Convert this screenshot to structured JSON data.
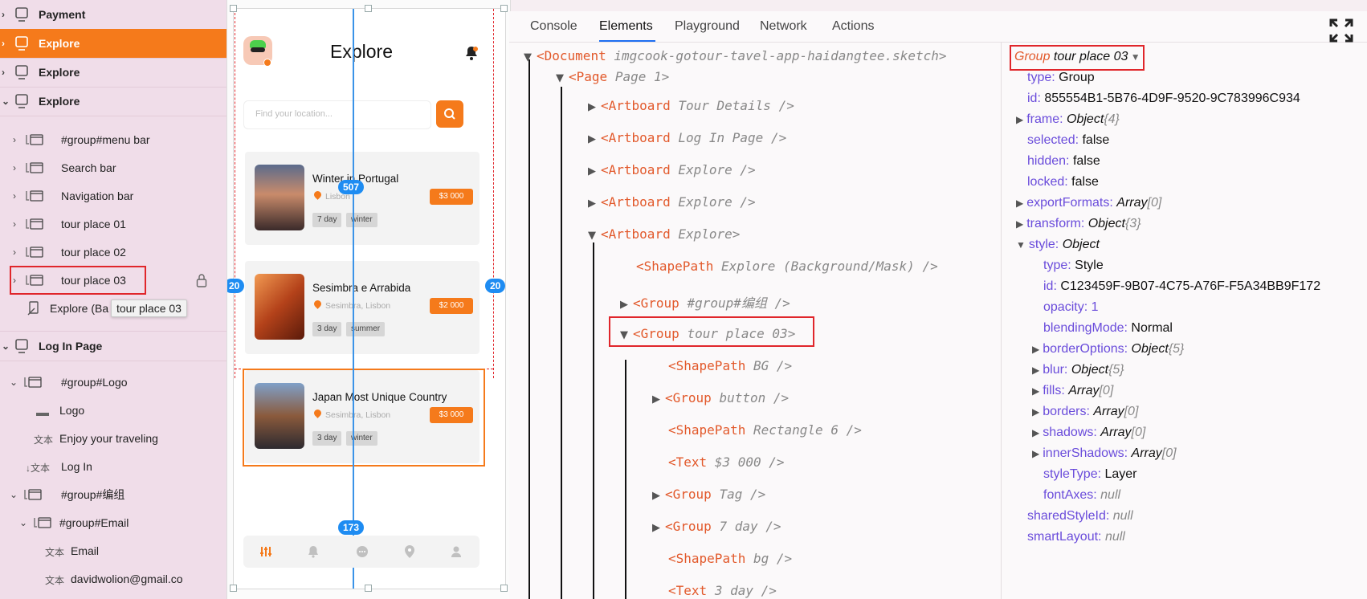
{
  "layers": {
    "artboards_top": [
      {
        "label": "Payment"
      },
      {
        "label": "Explore",
        "active": true
      },
      {
        "label": "Explore"
      },
      {
        "label": "Explore"
      }
    ],
    "explore_children": [
      {
        "label": "#group#menu bar"
      },
      {
        "label": "Search bar"
      },
      {
        "label": "Navigation bar"
      },
      {
        "label": "tour place 01"
      },
      {
        "label": "tour place 02"
      },
      {
        "label": "tour place 03",
        "selected": true
      }
    ],
    "mask_item": {
      "label": "Explore (Ba"
    },
    "tooltip": "tour place 03",
    "login_artboard": "Log In Page",
    "login_children": [
      {
        "label": "#group#Logo"
      },
      {
        "label": "Logo"
      },
      {
        "prefix": "文本",
        "label": "Enjoy your traveling"
      },
      {
        "prefix": "↓文本",
        "label": "Log In"
      },
      {
        "label": "#group#编组"
      },
      {
        "label": "#group#Email"
      },
      {
        "prefix": "文本",
        "label": "Email"
      },
      {
        "prefix": "文本",
        "label": "davidwolion@gmail.co"
      }
    ]
  },
  "phone": {
    "title": "Explore",
    "search_placeholder": "Find your location...",
    "cards": [
      {
        "title": "Winter in Portugal",
        "location": "Lisbon",
        "price": "$3 000",
        "tags": [
          "7 day",
          "winter"
        ]
      },
      {
        "title": "Sesimbra e Arrabida",
        "location": "Sesimbra, Lisbon",
        "price": "$2 000",
        "tags": [
          "3 day",
          "summer"
        ]
      },
      {
        "title": "Japan Most Unique Country",
        "location": "Sesimbra, Lisbon",
        "price": "$3 000",
        "tags": [
          "3 day",
          "winter"
        ]
      }
    ],
    "guides": {
      "top": "507",
      "bottom": "173",
      "left": "20",
      "right": "20"
    },
    "nav_icons": [
      "sliders-icon",
      "bell-icon",
      "chat-icon",
      "location-icon",
      "user-icon"
    ]
  },
  "devtools": {
    "tabs": [
      "Console",
      "Elements",
      "Playground",
      "Network",
      "Actions"
    ],
    "active_tab": "Elements",
    "tree": [
      {
        "indent": 0,
        "tri": "▼",
        "tag": "Document",
        "attr": "imgcook-gotour-tavel-app-haidangtee.sketch",
        "close": ">"
      },
      {
        "indent": 1,
        "tri": "▼",
        "tag": "Page",
        "attr": "Page 1",
        "close": ">"
      },
      {
        "indent": 2,
        "tri": "▶",
        "tag": "Artboard",
        "attr": "Tour Details",
        "close": " />"
      },
      {
        "indent": 2,
        "tri": "▶",
        "tag": "Artboard",
        "attr": "Log In Page",
        "close": " />"
      },
      {
        "indent": 2,
        "tri": "▶",
        "tag": "Artboard",
        "attr": "Explore",
        "close": " />"
      },
      {
        "indent": 2,
        "tri": "▶",
        "tag": "Artboard",
        "attr": "Explore",
        "close": " />"
      },
      {
        "indent": 2,
        "tri": "▼",
        "tag": "Artboard",
        "attr": "Explore",
        "close": ">"
      },
      {
        "indent": 3,
        "tri": "",
        "tag": "ShapePath",
        "attr": "Explore (Background/Mask)",
        "close": " />"
      },
      {
        "indent": 3,
        "tri": "▶",
        "tag": "Group",
        "attr": "#group#编组",
        "close": " />"
      },
      {
        "indent": 3,
        "tri": "▼",
        "tag": "Group",
        "attr": "tour place 03",
        "close": ">",
        "selected": true
      },
      {
        "indent": 4,
        "tri": "",
        "tag": "ShapePath",
        "attr": "BG",
        "close": " />"
      },
      {
        "indent": 4,
        "tri": "▶",
        "tag": "Group",
        "attr": "button",
        "close": " />"
      },
      {
        "indent": 4,
        "tri": "",
        "tag": "ShapePath",
        "attr": "Rectangle 6",
        "close": " />"
      },
      {
        "indent": 4,
        "tri": "",
        "tag": "Text",
        "attr": "$3 000",
        "close": " />"
      },
      {
        "indent": 4,
        "tri": "▶",
        "tag": "Group",
        "attr": "Tag",
        "close": " />"
      },
      {
        "indent": 4,
        "tri": "▶",
        "tag": "Group",
        "attr": "7 day",
        "close": " />"
      },
      {
        "indent": 4,
        "tri": "",
        "tag": "ShapePath",
        "attr": "bg",
        "close": " />"
      },
      {
        "indent": 4,
        "tri": "",
        "tag": "Text",
        "attr": "3 day",
        "close": " />"
      }
    ],
    "props_header": {
      "type": "Group",
      "name": "tour place 03"
    },
    "props": [
      {
        "indent": 0,
        "k": "type",
        "v": "Group",
        "style": "v"
      },
      {
        "indent": 0,
        "k": "id",
        "v": "855554B1-5B76-4D9F-9520-9C783996C934",
        "style": "v"
      },
      {
        "indent": 0,
        "k": "frame",
        "v": "Object",
        "extra": "{4}",
        "tri": "▶",
        "style": "vi"
      },
      {
        "indent": 0,
        "k": "selected",
        "v": "false",
        "style": "v"
      },
      {
        "indent": 0,
        "k": "hidden",
        "v": "false",
        "style": "v"
      },
      {
        "indent": 0,
        "k": "locked",
        "v": "false",
        "style": "v"
      },
      {
        "indent": 0,
        "k": "exportFormats",
        "v": "Array",
        "extra": "[0]",
        "tri": "▶",
        "style": "vi"
      },
      {
        "indent": 0,
        "k": "transform",
        "v": "Object",
        "extra": "{3}",
        "tri": "▶",
        "style": "vi"
      },
      {
        "indent": 0,
        "k": "style",
        "v": "Object",
        "tri": "▼",
        "style": "vi"
      },
      {
        "indent": 1,
        "k": "type",
        "v": "Style",
        "style": "v"
      },
      {
        "indent": 1,
        "k": "id",
        "v": "C123459F-9B07-4C75-A76F-F5A34BB9F172",
        "style": "v"
      },
      {
        "indent": 1,
        "k": "opacity",
        "v": "1",
        "style": "num"
      },
      {
        "indent": 1,
        "k": "blendingMode",
        "v": "Normal",
        "style": "v"
      },
      {
        "indent": 1,
        "k": "borderOptions",
        "v": "Object",
        "extra": "{5}",
        "tri": "▶",
        "style": "vi"
      },
      {
        "indent": 1,
        "k": "blur",
        "v": "Object",
        "extra": "{5}",
        "tri": "▶",
        "style": "vi"
      },
      {
        "indent": 1,
        "k": "fills",
        "v": "Array",
        "extra": "[0]",
        "tri": "▶",
        "style": "vi"
      },
      {
        "indent": 1,
        "k": "borders",
        "v": "Array",
        "extra": "[0]",
        "tri": "▶",
        "style": "vi"
      },
      {
        "indent": 1,
        "k": "shadows",
        "v": "Array",
        "extra": "[0]",
        "tri": "▶",
        "style": "vi"
      },
      {
        "indent": 1,
        "k": "innerShadows",
        "v": "Array",
        "extra": "[0]",
        "tri": "▶",
        "style": "vi"
      },
      {
        "indent": 1,
        "k": "styleType",
        "v": "Layer",
        "style": "v"
      },
      {
        "indent": 1,
        "k": "fontAxes",
        "v": "null",
        "style": "vg"
      },
      {
        "indent": 0,
        "k": "sharedStyleId",
        "v": "null",
        "style": "vg"
      },
      {
        "indent": 0,
        "k": "smartLayout",
        "v": "null",
        "style": "vg"
      }
    ]
  },
  "colors": {
    "accent": "#f57a1b",
    "highlight": "#e0262b",
    "guide": "#1e8cf2",
    "tag": "#e2592b",
    "key": "#6a4cdb"
  }
}
